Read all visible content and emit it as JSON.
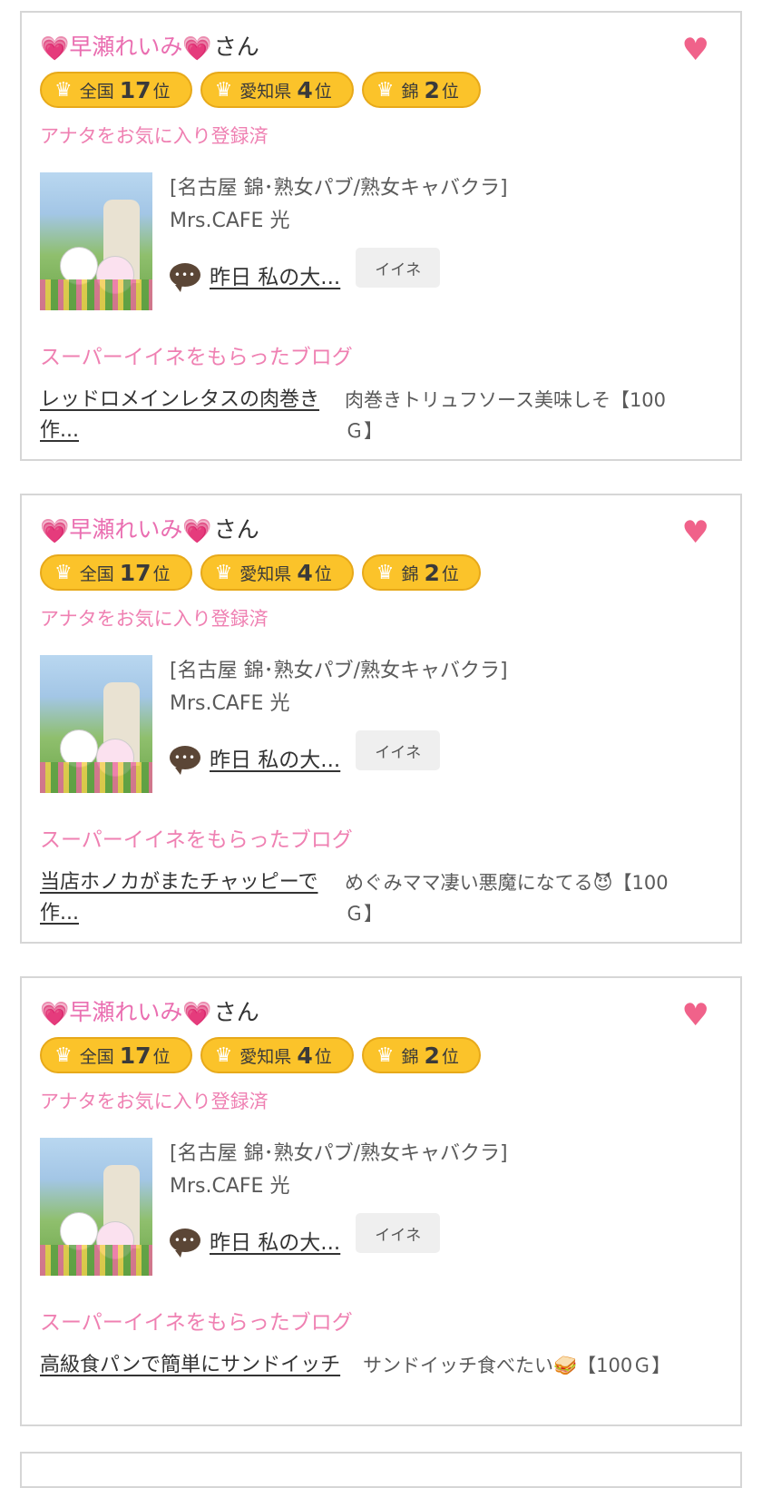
{
  "colors": {
    "pink_text": "#ef80b2",
    "heart_pink": "#f0628a",
    "badge_yellow": "#fbc32a",
    "border_gray": "#d6d6d6"
  },
  "icons": {
    "name_heart": "💗",
    "favorite": "♥",
    "crown": "♛"
  },
  "cards": [
    {
      "user_name": "早瀬れいみ",
      "name_suffix": "さん",
      "ranks": [
        {
          "region": "全国",
          "rank": "17",
          "unit": "位"
        },
        {
          "region": "愛知県",
          "rank": "4",
          "unit": "位"
        },
        {
          "region": "錦",
          "rank": "2",
          "unit": "位"
        }
      ],
      "favorite_status": "アナタをお気に入り登録済",
      "shop_category": "[名古屋 錦･熟女パブ/熟女キャバクラ]",
      "shop_name": "Mrs.CAFE 光",
      "comment_link": "昨日 私の大...",
      "iine_label": "イイネ",
      "super_label": "スーパーイイネをもらったブログ",
      "blog_title": "レッドロメインレタスの肉巻き作...",
      "blog_comment": "肉巻きトリュフソース美味しそ【100Ｇ】"
    },
    {
      "user_name": "早瀬れいみ",
      "name_suffix": "さん",
      "ranks": [
        {
          "region": "全国",
          "rank": "17",
          "unit": "位"
        },
        {
          "region": "愛知県",
          "rank": "4",
          "unit": "位"
        },
        {
          "region": "錦",
          "rank": "2",
          "unit": "位"
        }
      ],
      "favorite_status": "アナタをお気に入り登録済",
      "shop_category": "[名古屋 錦･熟女パブ/熟女キャバクラ]",
      "shop_name": "Mrs.CAFE 光",
      "comment_link": "昨日 私の大...",
      "iine_label": "イイネ",
      "super_label": "スーパーイイネをもらったブログ",
      "blog_title": "当店ホノカがまたチャッピーで作...",
      "blog_comment": "めぐみママ凄い悪魔になてる😈【100Ｇ】"
    },
    {
      "user_name": "早瀬れいみ",
      "name_suffix": "さん",
      "ranks": [
        {
          "region": "全国",
          "rank": "17",
          "unit": "位"
        },
        {
          "region": "愛知県",
          "rank": "4",
          "unit": "位"
        },
        {
          "region": "錦",
          "rank": "2",
          "unit": "位"
        }
      ],
      "favorite_status": "アナタをお気に入り登録済",
      "shop_category": "[名古屋 錦･熟女パブ/熟女キャバクラ]",
      "shop_name": "Mrs.CAFE 光",
      "comment_link": "昨日 私の大...",
      "iine_label": "イイネ",
      "super_label": "スーパーイイネをもらったブログ",
      "blog_title": "高級食パンで簡単にサンドイッチ",
      "blog_comment": "サンドイッチ食べたい🥪【100Ｇ】"
    }
  ]
}
